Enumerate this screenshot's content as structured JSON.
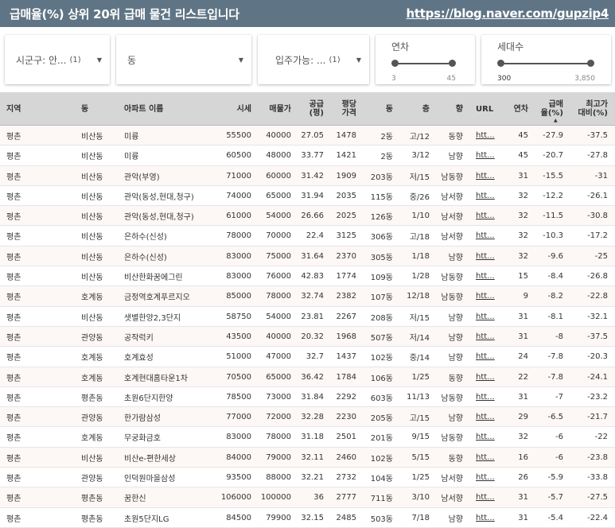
{
  "header": {
    "title": "급매율(%) 상위 20위 급매 물건 리스트입니다",
    "url": "https://blog.naver.com/gupzip4"
  },
  "filters": {
    "district": {
      "label": "시군구: 안...",
      "count": "(1)"
    },
    "dong": {
      "label": "동"
    },
    "move_in": {
      "label": "입주가능: ...",
      "count": "(1)"
    },
    "age": {
      "label": "연차",
      "min": "3",
      "max": "45"
    },
    "households": {
      "label": "세대수",
      "min": "300",
      "max": "3,850"
    }
  },
  "table": {
    "columns": [
      {
        "key": "region",
        "label": "지역"
      },
      {
        "key": "dong",
        "label": "동"
      },
      {
        "key": "apt",
        "label": "아파트 이름"
      },
      {
        "key": "market",
        "label": "시세"
      },
      {
        "key": "price",
        "label": "매물가"
      },
      {
        "key": "area",
        "label": "공급\n(평)"
      },
      {
        "key": "per_pyeong",
        "label": "평당\n가격"
      },
      {
        "key": "building",
        "label": "동"
      },
      {
        "key": "floor",
        "label": "층"
      },
      {
        "key": "direction",
        "label": "향"
      },
      {
        "key": "url",
        "label": "URL"
      },
      {
        "key": "age",
        "label": "연차"
      },
      {
        "key": "discount",
        "label": "급매\n율(%)"
      },
      {
        "key": "vs_max",
        "label": "최고가\n대비(%)"
      }
    ],
    "rows": [
      [
        "평촌",
        "비산동",
        "미륭",
        "55500",
        "40000",
        "27.05",
        "1478",
        "2동",
        "고/12",
        "동향",
        "htt...",
        "45",
        "-27.9",
        "-37.5"
      ],
      [
        "평촌",
        "비산동",
        "미륭",
        "60500",
        "48000",
        "33.77",
        "1421",
        "2동",
        "3/12",
        "남향",
        "htt...",
        "45",
        "-20.7",
        "-27.8"
      ],
      [
        "평촌",
        "비산동",
        "관악(부영)",
        "71000",
        "60000",
        "31.42",
        "1909",
        "203동",
        "저/15",
        "남동향",
        "htt...",
        "31",
        "-15.5",
        "-31"
      ],
      [
        "평촌",
        "비산동",
        "관악(동성,현대,청구)",
        "74000",
        "65000",
        "31.94",
        "2035",
        "115동",
        "중/26",
        "남서향",
        "htt...",
        "32",
        "-12.2",
        "-26.1"
      ],
      [
        "평촌",
        "비산동",
        "관악(동성,현대,청구)",
        "61000",
        "54000",
        "26.66",
        "2025",
        "126동",
        "1/10",
        "남서향",
        "htt...",
        "32",
        "-11.5",
        "-30.8"
      ],
      [
        "평촌",
        "비산동",
        "은하수(신성)",
        "78000",
        "70000",
        "22.4",
        "3125",
        "306동",
        "고/18",
        "남서향",
        "htt...",
        "32",
        "-10.3",
        "-17.2"
      ],
      [
        "평촌",
        "비산동",
        "은하수(신성)",
        "83000",
        "75000",
        "31.64",
        "2370",
        "305동",
        "1/18",
        "남향",
        "htt...",
        "32",
        "-9.6",
        "-25"
      ],
      [
        "평촌",
        "비산동",
        "비산한화꿈에그린",
        "83000",
        "76000",
        "42.83",
        "1774",
        "109동",
        "1/28",
        "남동향",
        "htt...",
        "15",
        "-8.4",
        "-26.8"
      ],
      [
        "평촌",
        "호계동",
        "금정역호계푸르지오",
        "85000",
        "78000",
        "32.74",
        "2382",
        "107동",
        "12/18",
        "남동향",
        "htt...",
        "9",
        "-8.2",
        "-22.8"
      ],
      [
        "평촌",
        "비산동",
        "샛별한양2,3단지",
        "58750",
        "54000",
        "23.81",
        "2267",
        "208동",
        "저/15",
        "남향",
        "htt...",
        "31",
        "-8.1",
        "-32.1"
      ],
      [
        "평촌",
        "관양동",
        "공작럭키",
        "43500",
        "40000",
        "20.32",
        "1968",
        "507동",
        "저/14",
        "남향",
        "htt...",
        "31",
        "-8",
        "-37.5"
      ],
      [
        "평촌",
        "호계동",
        "호계효성",
        "51000",
        "47000",
        "32.7",
        "1437",
        "102동",
        "중/14",
        "남향",
        "htt...",
        "24",
        "-7.8",
        "-20.3"
      ],
      [
        "평촌",
        "호계동",
        "호계현대홈타운1차",
        "70500",
        "65000",
        "36.42",
        "1784",
        "106동",
        "1/25",
        "동향",
        "htt...",
        "22",
        "-7.8",
        "-24.1"
      ],
      [
        "평촌",
        "평촌동",
        "초원6단지한양",
        "78500",
        "73000",
        "31.84",
        "2292",
        "603동",
        "11/13",
        "남동향",
        "htt...",
        "31",
        "-7",
        "-23.2"
      ],
      [
        "평촌",
        "관양동",
        "한가람삼성",
        "77000",
        "72000",
        "32.28",
        "2230",
        "205동",
        "고/15",
        "남향",
        "htt...",
        "29",
        "-6.5",
        "-21.7"
      ],
      [
        "평촌",
        "호계동",
        "무궁화금호",
        "83000",
        "78000",
        "31.18",
        "2501",
        "201동",
        "9/15",
        "남동향",
        "htt...",
        "32",
        "-6",
        "-22"
      ],
      [
        "평촌",
        "비산동",
        "비산e-편한세상",
        "84000",
        "79000",
        "32.11",
        "2460",
        "102동",
        "5/15",
        "동향",
        "htt...",
        "16",
        "-6",
        "-23.8"
      ],
      [
        "평촌",
        "관양동",
        "인덕원마을삼성",
        "93500",
        "88000",
        "32.21",
        "2732",
        "104동",
        "1/25",
        "남서향",
        "htt...",
        "26",
        "-5.9",
        "-33.8"
      ],
      [
        "평촌",
        "평촌동",
        "꿈한신",
        "106000",
        "100000",
        "36",
        "2777",
        "711동",
        "3/10",
        "남서향",
        "htt...",
        "31",
        "-5.7",
        "-27.5"
      ],
      [
        "평촌",
        "평촌동",
        "초원5단지LG",
        "84500",
        "79900",
        "32.15",
        "2485",
        "503동",
        "7/18",
        "남향",
        "htt...",
        "31",
        "-5.4",
        "-22.4"
      ]
    ]
  },
  "colors": {
    "header_bg": "#5f7585",
    "table_header_bg": "#d6d6d6",
    "row_alt_bg": "#fdf8f5"
  }
}
